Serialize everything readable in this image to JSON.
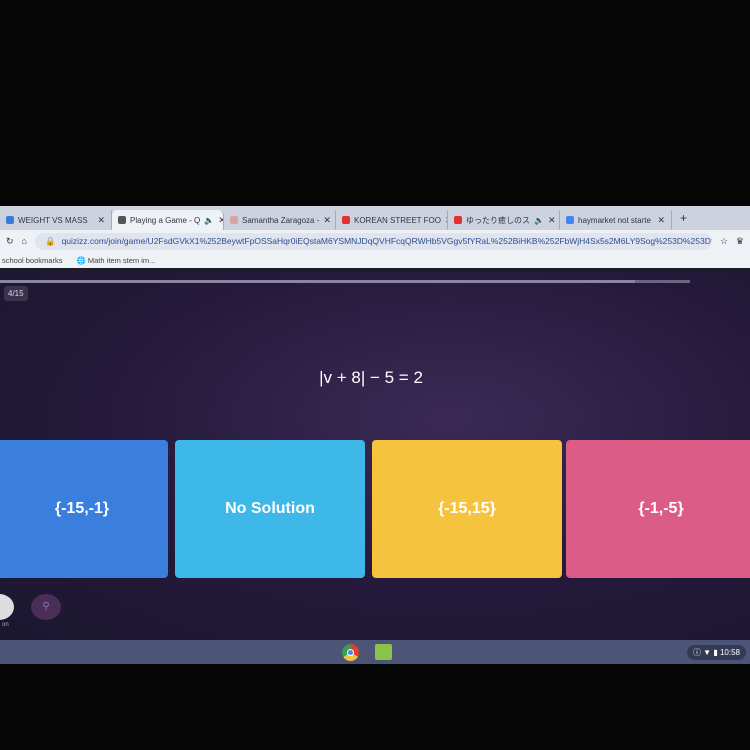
{
  "browser": {
    "tabs": [
      {
        "title": "WEIGHT VS MASS",
        "fav": "#3b7bd8"
      },
      {
        "title": "Playing a Game - Q",
        "fav": "#555",
        "active": true,
        "audio": true
      },
      {
        "title": "Samantha Zaragoza -",
        "fav": "#d9a4a4"
      },
      {
        "title": "KOREAN STREET FOO",
        "fav": "#e03030"
      },
      {
        "title": "ゆったり癒しのス",
        "fav": "#e03030",
        "audio": true
      },
      {
        "title": "haymarket not starte",
        "fav": "#4285f4"
      }
    ],
    "new_tab": "+",
    "url": "quizizz.com/join/game/U2FsdGVkX1%252BeywtFpOSSaHqr0iEQstaM6YSMNJDqQVHFcqQRWHb5VGgv5fYRaL%252BiHKB%252FbWjH4Sx5s2M6LY9Sog%253D%253D?g...",
    "bookmarks": [
      "school bookmarks",
      "Math item stem im..."
    ]
  },
  "quiz": {
    "counter": "4/15",
    "progress": 0.92,
    "question": "|v + 8| − 5 = 2",
    "options": [
      {
        "label": "{-15,-1}",
        "color": "#3a7fde"
      },
      {
        "label": "No Solution",
        "color": "#3db8e8"
      },
      {
        "label": "{-15,15}",
        "color": "#f5c33e"
      },
      {
        "label": "{-1,-5}",
        "color": "#dc5c88"
      }
    ],
    "powerups": [
      "on",
      ""
    ]
  },
  "taskbar": {
    "time": "10:58"
  }
}
